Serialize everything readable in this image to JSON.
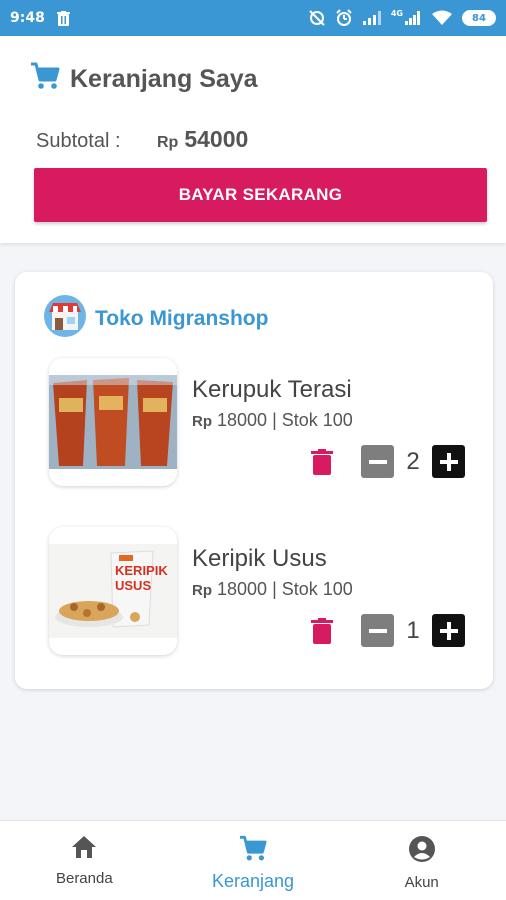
{
  "status_bar": {
    "time": "9:48",
    "battery": "84",
    "network": "4G"
  },
  "header": {
    "title": "Keranjang Saya",
    "subtotal_label": "Subtotal :",
    "subtotal_currency": "Rp",
    "subtotal_value": "54000",
    "pay_button_label": "BAYAR SEKARANG"
  },
  "shop": {
    "name": "Toko Migranshop",
    "items": [
      {
        "name": "Kerupuk Terasi",
        "currency": "Rp",
        "price": "18000",
        "separator": "|",
        "stock": "Stok 100",
        "quantity": "2"
      },
      {
        "name": "Keripik Usus",
        "currency": "Rp",
        "price": "18000",
        "separator": "|",
        "stock": "Stok 100",
        "quantity": "1",
        "package_text": "KERIPIK USUS"
      }
    ]
  },
  "bottom_nav": {
    "items": [
      {
        "label": "Beranda",
        "icon": "home-icon",
        "active": false
      },
      {
        "label": "Keranjang",
        "icon": "cart-icon",
        "active": true
      },
      {
        "label": "Akun",
        "icon": "account-icon",
        "active": false
      }
    ]
  },
  "colors": {
    "primary_blue": "#3a97d4",
    "accent_pink": "#d81b60",
    "minus_gray": "#7e7e7e",
    "plus_black": "#111111"
  }
}
